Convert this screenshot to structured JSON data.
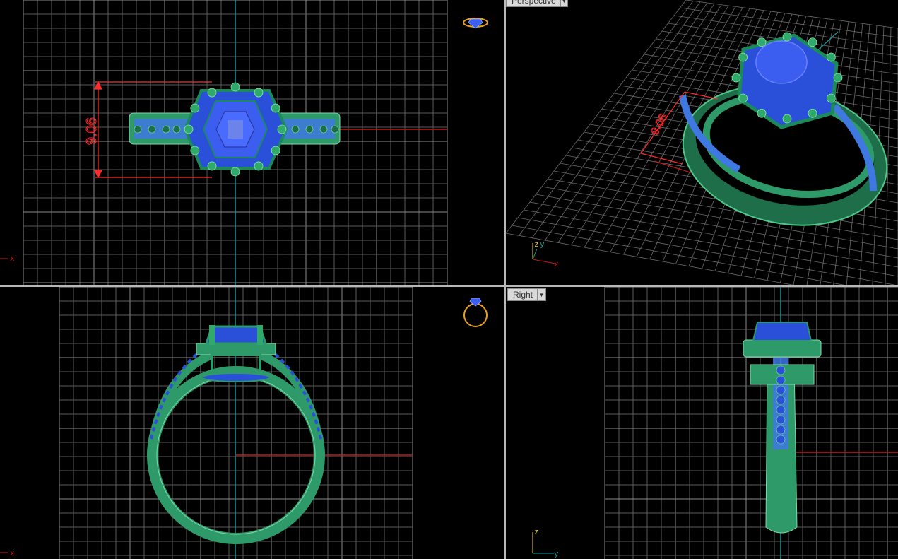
{
  "viewports": {
    "top": {
      "axis_x": "x",
      "dimension": "9.06"
    },
    "perspective": {
      "label": "Perspective",
      "axis_x": "x",
      "axis_y": "y",
      "axis_z": "z",
      "dimension": "9.06"
    },
    "front": {
      "axis_x": "x"
    },
    "right": {
      "label": "Right",
      "axis_y": "y",
      "axis_z": "z"
    }
  },
  "colors": {
    "background": "#000000",
    "grid": "#5a5a5a",
    "grid_major": "#8a8a8a",
    "x_axis": "#c21a1a",
    "y_axis": "#1c9a9a",
    "metal": "#2e9a6a",
    "metal_dark": "#1f6e4a",
    "gem": "#2a4fd8",
    "gem_light": "#5a7cff",
    "dimension": "#ff2a2a",
    "gumball": "#e8a020"
  },
  "icons": [
    "ring-top-icon",
    "ring-front-icon",
    "dropdown-arrow-icon"
  ]
}
